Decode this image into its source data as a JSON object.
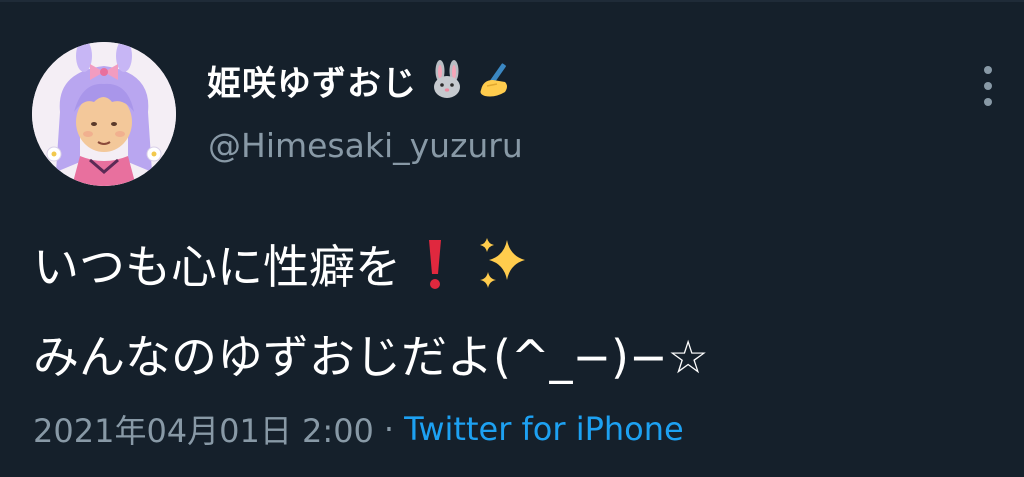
{
  "tweet": {
    "author": {
      "display_name": "姫咲ゆずおじ",
      "name_emojis": [
        "rabbit-face-icon",
        "writing-hand-icon"
      ],
      "handle": "@Himesaki_yuzuru",
      "avatar": "anime-girl-avatar"
    },
    "text_lines": [
      "いつも心に性癖を",
      "みんなのゆずおじだよ(^_−)−☆"
    ],
    "text_emojis": [
      "red-exclamation-icon",
      "sparkles-icon"
    ],
    "timestamp": "2021年04月01日 2:00",
    "separator": "·",
    "source": "Twitter for iPhone",
    "more_icon": "more-vertical-icon"
  },
  "colors": {
    "background": "#15202b",
    "text_primary": "#ffffff",
    "text_secondary": "#8899a6",
    "link": "#1da1f2"
  }
}
